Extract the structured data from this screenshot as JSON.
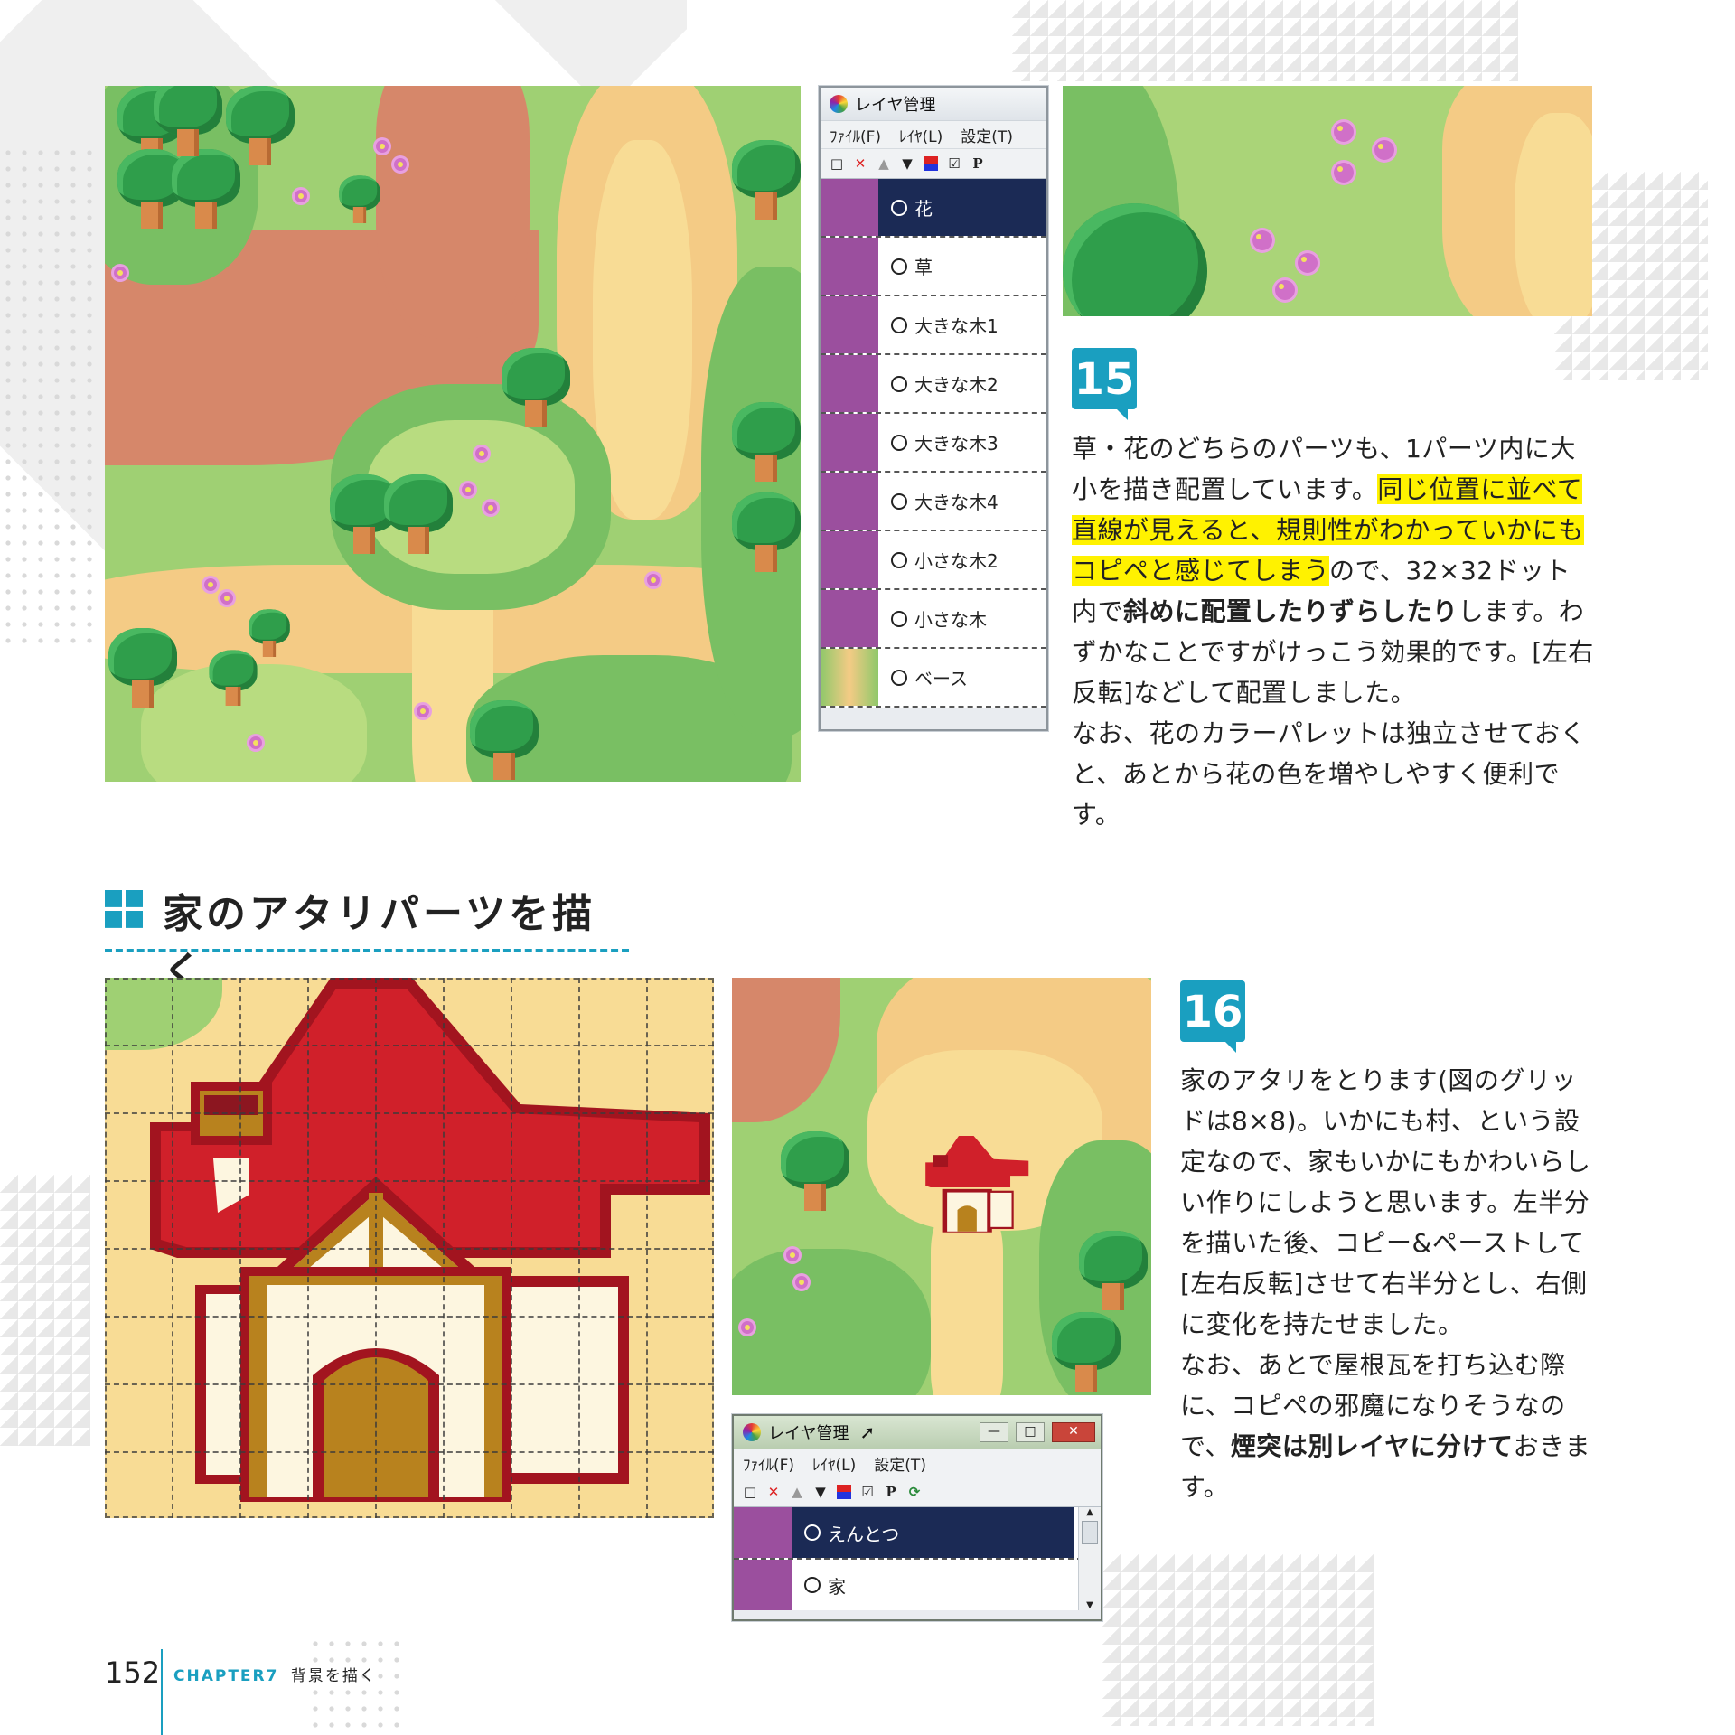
{
  "top_map": {
    "alt": "field map"
  },
  "layer_window_1": {
    "title": "レイヤ管理",
    "menu": [
      "ﾌｧｲﾙ(F)",
      "ﾚｲﾔ(L)",
      "設定(T)"
    ],
    "layers": [
      "花",
      "草",
      "大きな木1",
      "大きな木2",
      "大きな木3",
      "大きな木4",
      "小さな木2",
      "小さな木",
      "ベース"
    ]
  },
  "step15": {
    "number": "15",
    "p1_a": "草・花のどちらのパーツも、1パーツ内に大小を描き配置しています。",
    "p1_hl": "同じ位置に並べて直線が見えると、規則性がわかっていかにもコピペと感じてしまう",
    "p1_b": "ので、32×32ドット内で",
    "p1_bold": "斜めに配置したりずらしたり",
    "p1_c": "します。わずかなことですがけっこう効果的です。[左右反転]などして配置しました。",
    "p2": "なお、花のカラーパレットは独立させておくと、あとから花の色を増やしやすく便利です。"
  },
  "section": {
    "title": "家のアタリパーツを描く"
  },
  "layer_window_2": {
    "title": "レイヤ管理",
    "menu": [
      "ﾌｧｲﾙ(F)",
      "ﾚｲﾔ(L)",
      "設定(T)"
    ],
    "layers": [
      "えんとつ",
      "家"
    ]
  },
  "step16": {
    "number": "16",
    "p1": "家のアタリをとります(図のグリッドは8×8)。いかにも村、という設定なので、家もいかにもかわいらしい作りにしようと思います。左半分を描いた後、コピー&ペーストして[左右反転]させて右半分とし、右側に変化を持たせました。",
    "p2_a": "なお、あとで屋根瓦を打ち込む際に、コピペの邪魔になりそうなので、",
    "p2_bold": "煙突は別レイヤに分けて",
    "p2_b": "おきます。"
  },
  "footer": {
    "page": "152",
    "chapter": "CHAPTER7",
    "chapter_title": "背景を描く"
  },
  "colors": {
    "accent": "#1a9fc0",
    "highlight": "#fff200",
    "roof": "#d0202a",
    "wood": "#b8821e"
  }
}
